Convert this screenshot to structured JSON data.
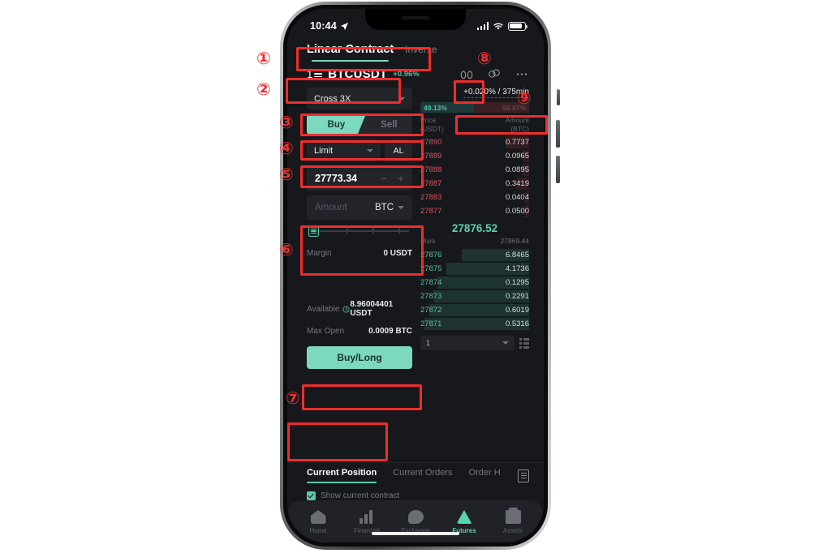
{
  "status_bar": {
    "time": "10:44",
    "location_icon": "location-arrow-icon"
  },
  "header": {
    "contract_tab_active": "Linear Contract",
    "contract_tab_inactive": "Inverse",
    "pair": "BTCUSDT",
    "pair_change": "+0.96%",
    "list_icon_label": "1",
    "icons": [
      "binoculars-icon",
      "chain-link-icon",
      "more-dots-icon"
    ]
  },
  "order_form": {
    "margin_mode": "Cross  3X",
    "buy_label": "Buy",
    "sell_label": "Sell",
    "order_type": "Limit",
    "al_label": "AL",
    "price_value": "27773.34",
    "minus": "−",
    "plus": "+",
    "amount_placeholder": "Amount",
    "amount_unit": "BTC",
    "margin_label": "Margin",
    "margin_value": "0 USDT",
    "available_label": "Available",
    "available_value": "8.96004401 USDT",
    "max_open_label": "Max Open",
    "max_open_value": "0.0009 BTC",
    "submit_label": "Buy/Long"
  },
  "order_book": {
    "funding": "+0.020% / 375min",
    "buy_depth_pct": "49.13%",
    "sell_depth_pct": "50.87%",
    "col_price": "Price",
    "col_price_unit": "(USDT)",
    "col_amount": "Amount",
    "col_amount_unit": "(BTC)",
    "asks": [
      {
        "price": "27890",
        "amount": "0.7737",
        "depth": 22
      },
      {
        "price": "27889",
        "amount": "0.0965",
        "depth": 6
      },
      {
        "price": "27888",
        "amount": "0.0895",
        "depth": 6
      },
      {
        "price": "27887",
        "amount": "0.3419",
        "depth": 12
      },
      {
        "price": "27883",
        "amount": "0.0404",
        "depth": 4
      },
      {
        "price": "27877",
        "amount": "0.0500",
        "depth": 5
      }
    ],
    "last_price": "27876.52",
    "mark_label": "Mark",
    "mark_value": "27869.44",
    "bids": [
      {
        "price": "27876",
        "amount": "6.8465",
        "depth": 62
      },
      {
        "price": "27875",
        "amount": "4.1736",
        "depth": 76
      },
      {
        "price": "27874",
        "amount": "0.1295",
        "depth": 84
      },
      {
        "price": "27873",
        "amount": "0.2291",
        "depth": 88
      },
      {
        "price": "27872",
        "amount": "0.6019",
        "depth": 92
      },
      {
        "price": "27871",
        "amount": "0.5316",
        "depth": 96
      }
    ],
    "grouping": "1",
    "grid_icon": "layout-grid-icon"
  },
  "bottom_tabs": {
    "tabs": [
      "Current Position",
      "Current Orders",
      "Order H"
    ],
    "doc_icon": "document-icon",
    "show_current_contract": "Show current contract"
  },
  "nav": {
    "items": [
      {
        "label": "Home",
        "icon": "home-icon"
      },
      {
        "label": "Financial",
        "icon": "bar-chart-icon"
      },
      {
        "label": "Exchange",
        "icon": "exchange-icon"
      },
      {
        "label": "Futures",
        "icon": "futures-icon"
      },
      {
        "label": "Assets",
        "icon": "wallet-icon"
      }
    ]
  },
  "annotations": {
    "markers": [
      "①",
      "②",
      "③",
      "④",
      "⑤",
      "⑥",
      "⑦",
      "⑧",
      "⑨"
    ],
    "color": "#ef2d2d"
  }
}
